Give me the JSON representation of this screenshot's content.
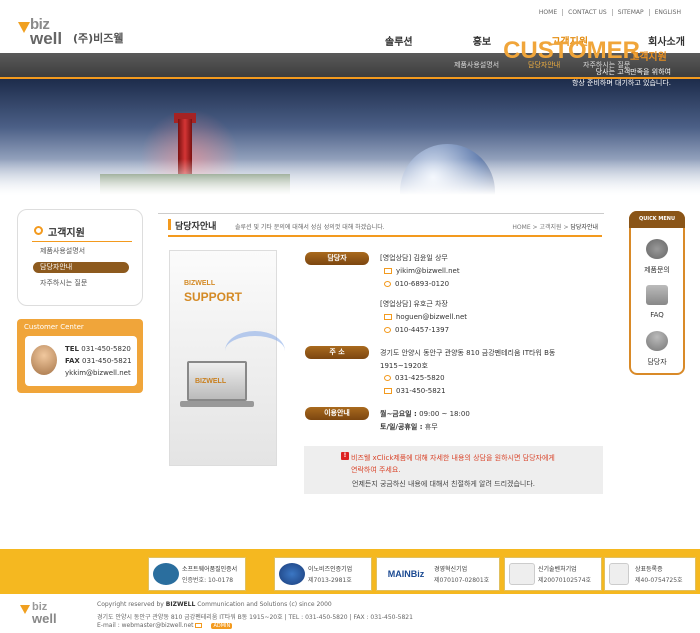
{
  "header": {
    "logo_top": "biz",
    "logo_bottom": "well",
    "company_name": "(주)비즈웰",
    "util_links": [
      "HOME",
      "CONTACT US",
      "SITEMAP",
      "ENGLISH"
    ],
    "gnb": [
      "솔루션",
      "홍보",
      "고객지원",
      "회사소개"
    ],
    "subnav": [
      "제품사용설명서",
      "담당자안내",
      "자주하시는 질문"
    ]
  },
  "banner": {
    "title": "CUSTOMER",
    "title_kr": "고객지원",
    "line1": "당사는 고객만족을 위하여",
    "line2": "항상 준비하며 대기하고 있습니다."
  },
  "sidebar": {
    "title": "고객지원",
    "items": [
      {
        "label": "제품사용설명서"
      },
      {
        "label": "담당자안내"
      },
      {
        "label": "자주하시는 질문"
      }
    ],
    "center_title": "Customer Center",
    "tel_label": "TEL",
    "tel": "031-450-5820",
    "fax_label": "FAX",
    "fax": "031-450-5821",
    "email": "ykkim@bizwell.net"
  },
  "main": {
    "title": "담당자안내",
    "desc": "솔루션 및 기타 문의에 대해서 성심 성의껏 대해 하겠습니다.",
    "breadcrumb": [
      "HOME",
      "고객지원",
      "담당자안내"
    ],
    "card_top": "BIZWELL",
    "card_bottom": "SUPPORT",
    "card_screen": "BIZWELL",
    "contact_label": "담당자",
    "contacts": [
      {
        "name": "[영업상담] 김윤일 상무",
        "email": "yikim@bizwell.net",
        "phone": "010-6893-0120"
      },
      {
        "name": "[영업상담] 유호근 차장",
        "email": "hoguen@bizwell.net",
        "phone": "010-4457-1397"
      }
    ],
    "address_label": "주 소",
    "address": "경기도 안양시 동안구 관양동 810 금강펜테리움 IT타워 B동",
    "address2": "1915~1920호",
    "tel": "031-425-5820",
    "fax": "031-450-5821",
    "hours_label": "이용안내",
    "hours_weekday_label": "월~금요일 :",
    "hours_weekday": "09:00 ~ 18:00",
    "hours_weekend_label": "토/일/공휴일 :",
    "hours_weekend": "휴무",
    "notice_line1": "비즈웰 xClick제품에 대해 자세한 내용의 상담을 원하시면 담당자에게",
    "notice_line1b": "연락하여 주세요.",
    "notice_line2": "언제든지 궁금하신 내용에 대해서 친절하게 알려 드리겠습니다."
  },
  "quick_menu": {
    "title": "QUICK MENU",
    "items": [
      "제품문의",
      "FAQ",
      "담당자"
    ]
  },
  "footer": {
    "certs": [
      {
        "title": "소프트웨어품질인증서",
        "sub": "인증번호: 10-0178"
      },
      {
        "title": "이노비즈인증기업",
        "sub": "제7013-2981호"
      },
      {
        "title": "경영혁신기업",
        "sub": "제070107-02801호"
      },
      {
        "title": "신기술벤처기업",
        "sub": "제20070102574호"
      },
      {
        "title": "상표등록증",
        "sub": "제40-0754725호"
      }
    ],
    "copyright_pre": "Copyright reserved by",
    "copyright_brand": "BIZWELL",
    "copyright_post": "Communication and Solutions (c) since 2000",
    "address_line": "경기도 안양시 동안구 관양동 810 금강펜테리움 IT타워 B동 1915~20호 | TEL : 031-450-5820 | FAX : 031-450-5821",
    "email_line": "E-mail : webmaster@bizwell.net",
    "admin": "ADMIN"
  }
}
